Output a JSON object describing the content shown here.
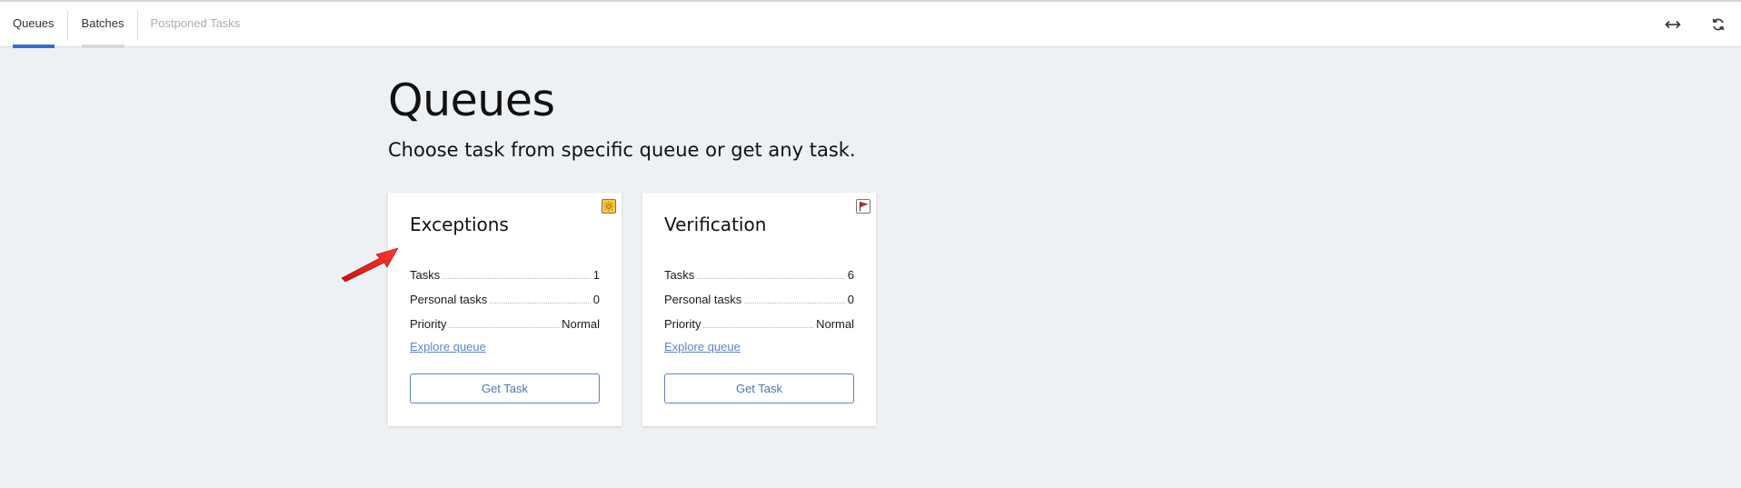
{
  "nav": {
    "tabs": [
      {
        "label": "Queues"
      },
      {
        "label": "Batches"
      },
      {
        "label": "Postponed Tasks"
      }
    ],
    "icons": [
      "expand-horizontal-icon",
      "refresh-icon"
    ]
  },
  "page": {
    "title": "Queues",
    "subtitle": "Choose task from specific queue or get any task."
  },
  "queues": [
    {
      "name": "Exceptions",
      "badge_icon": "sun-icon",
      "tasks_label": "Tasks",
      "tasks": "1",
      "personal_label": "Personal tasks",
      "personal": "0",
      "priority_label": "Priority",
      "priority": "Normal",
      "explore_label": "Explore queue",
      "button_label": "Get Task"
    },
    {
      "name": "Verification",
      "badge_icon": "flag-icon",
      "tasks_label": "Tasks",
      "tasks": "6",
      "personal_label": "Personal tasks",
      "personal": "0",
      "priority_label": "Priority",
      "priority": "Normal",
      "explore_label": "Explore queue",
      "button_label": "Get Task"
    }
  ],
  "colors": {
    "accent": "#2f6fd6",
    "link": "#5b84c9",
    "background": "#eef1f4",
    "arrow": "#e8201c"
  }
}
